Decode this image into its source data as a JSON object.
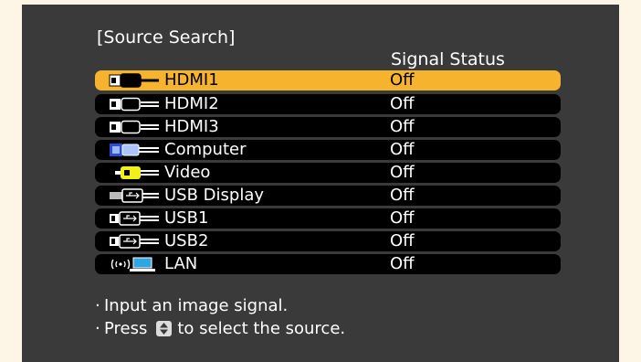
{
  "window": {
    "title": "[Source Search]"
  },
  "table": {
    "status_header": "Signal Status",
    "rows": [
      {
        "label": "HDMI1",
        "status": "Off",
        "icon": "hdmi-cable-icon",
        "selected": true
      },
      {
        "label": "HDMI2",
        "status": "Off",
        "icon": "hdmi-cable-icon",
        "selected": false
      },
      {
        "label": "HDMI3",
        "status": "Off",
        "icon": "hdmi-cable-icon",
        "selected": false
      },
      {
        "label": "Computer",
        "status": "Off",
        "icon": "vga-cable-icon",
        "selected": false
      },
      {
        "label": "Video",
        "status": "Off",
        "icon": "rca-cable-icon",
        "selected": false
      },
      {
        "label": "USB Display",
        "status": "Off",
        "icon": "usb-cable-icon",
        "selected": false
      },
      {
        "label": "USB1",
        "status": "Off",
        "icon": "usb-cable-icon",
        "selected": false
      },
      {
        "label": "USB2",
        "status": "Off",
        "icon": "usb-cable-icon",
        "selected": false
      },
      {
        "label": "LAN",
        "status": "Off",
        "icon": "wireless-lan-icon",
        "selected": false
      }
    ]
  },
  "instructions": {
    "bullet": "·",
    "line1": "Input an image signal.",
    "line2_prefix": "Press",
    "line2_icon": "up-down-arrow-icon",
    "line2_suffix": "to select the source."
  },
  "colors": {
    "selected_row": "#f6b32e",
    "row": "#000000",
    "panel": "#3a3a3a",
    "border": "#fdf6e6"
  }
}
